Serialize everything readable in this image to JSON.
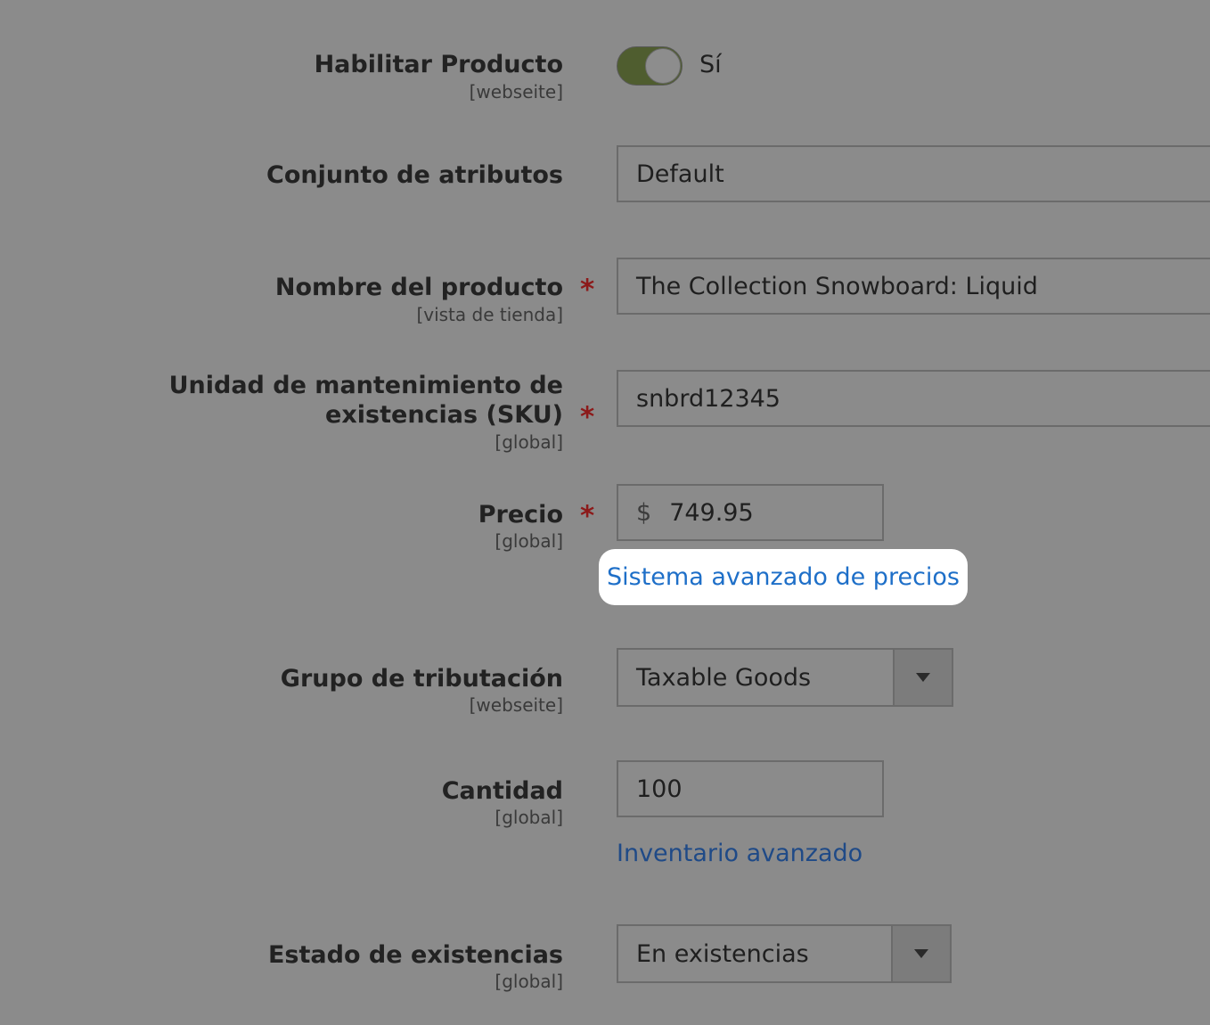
{
  "fields": {
    "enable_product": {
      "label": "Habilitar Producto",
      "scope": "[webseite]",
      "toggle_value": "Sí",
      "toggle_on": true
    },
    "attribute_set": {
      "label": "Conjunto de atributos",
      "value": "Default"
    },
    "product_name": {
      "label": "Nombre del producto",
      "scope": "[vista de tienda]",
      "required_mark": "*",
      "value": "The Collection Snowboard: Liquid"
    },
    "sku": {
      "label": "Unidad de mantenimiento de existencias (SKU)",
      "scope": "[global]",
      "required_mark": "*",
      "value": "snbrd12345"
    },
    "price": {
      "label": "Precio",
      "scope": "[global]",
      "required_mark": "*",
      "currency": "$",
      "value": "749.95",
      "link": "Sistema avanzado de precios"
    },
    "tax_class": {
      "label": "Grupo de tributación",
      "scope": "[webseite]",
      "value": "Taxable Goods"
    },
    "quantity": {
      "label": "Cantidad",
      "scope": "[global]",
      "value": "100",
      "link": "Inventario avanzado"
    },
    "stock_status": {
      "label": "Estado de existencias",
      "scope": "[global]",
      "value": "En existencias"
    }
  },
  "colors": {
    "overlay": "#8b8b8b",
    "toggle_on": "#4f5d2f",
    "link_highlight": "#1e6fc8",
    "link_dim": "#1f4a87",
    "required": "#8c1a1a"
  },
  "icons": {
    "dropdown": "chevron-down-icon"
  }
}
